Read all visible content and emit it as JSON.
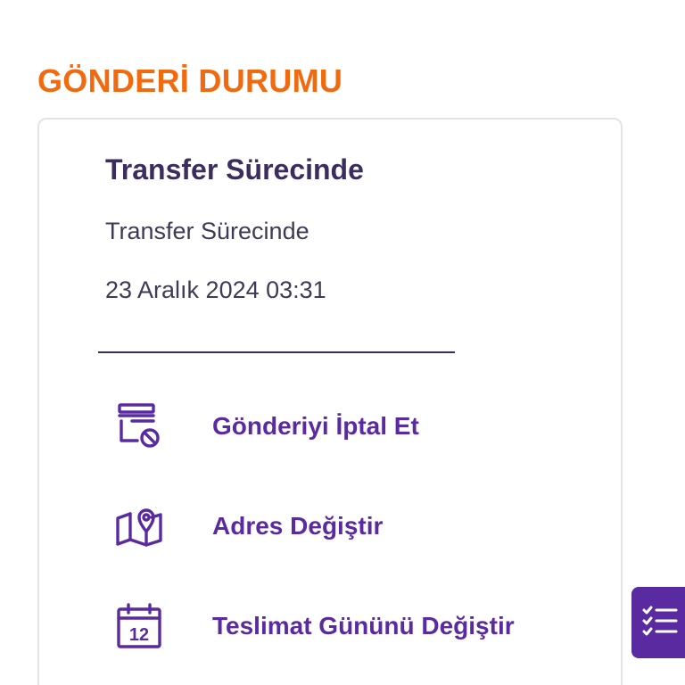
{
  "section": {
    "title": "GÖNDERİ DURUMU"
  },
  "status": {
    "heading": "Transfer Sürecinde",
    "description": "Transfer Sürecinde",
    "datetime": "23 Aralık 2024 03:31"
  },
  "actions": [
    {
      "label": "Gönderiyi İptal Et",
      "icon": "cancel-shipment-icon"
    },
    {
      "label": "Adres Değiştir",
      "icon": "map-pin-icon"
    },
    {
      "label": "Teslimat Gününü Değiştir",
      "icon": "calendar-icon",
      "icon_text": "12"
    }
  ],
  "fab": {
    "icon": "checklist-icon"
  },
  "colors": {
    "title_orange": "#f26a0f",
    "brand_purple": "#5a2ba0",
    "heading_dark": "#3b2e5e",
    "text_gray": "#3f3a55",
    "card_border": "#e3e3e6"
  }
}
